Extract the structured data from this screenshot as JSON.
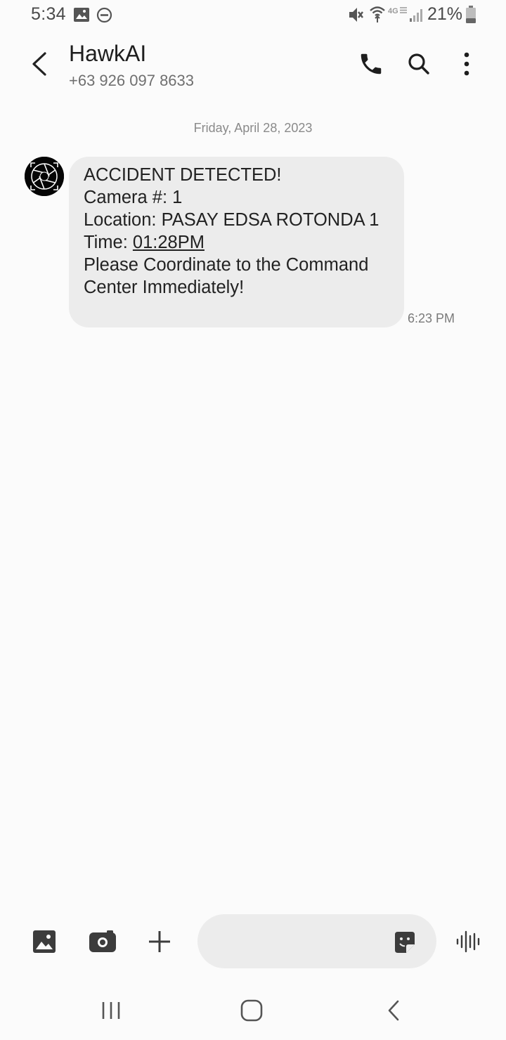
{
  "status_bar": {
    "time": "5:34",
    "battery_percent": "21%",
    "icons": [
      "image-icon",
      "do-not-disturb-icon",
      "vibrate-mute-icon",
      "wifi-icon",
      "4g-lte-icon",
      "signal-icon",
      "battery-icon"
    ]
  },
  "header": {
    "contact_name": "HawkAI",
    "contact_number": "+63 926 097 8633",
    "icons": [
      "back-arrow-icon",
      "phone-icon",
      "search-icon",
      "more-options-icon"
    ]
  },
  "conversation": {
    "date_separator": "Friday, April 28, 2023",
    "message": {
      "line1": "ACCIDENT DETECTED!",
      "line2": "Camera #: 1",
      "line3": "Location: PASAY EDSA ROTONDA 1",
      "line4_prefix": "Time: ",
      "line4_link": "01:28PM",
      "line5": "Please Coordinate to the Command",
      "line6": "Center Immediately!",
      "time": "6:23 PM"
    }
  },
  "compose": {
    "input_value": "",
    "icons": [
      "gallery-icon",
      "camera-icon",
      "add-icon",
      "sticker-icon",
      "voice-recorder-icon"
    ]
  },
  "navigation": {
    "icons": [
      "recent-apps-icon",
      "home-icon",
      "nav-back-icon"
    ]
  },
  "colors": {
    "background": "#fbfbfb",
    "bubble": "#ececec",
    "text": "#222222",
    "secondary_text": "#6f6f6f"
  }
}
